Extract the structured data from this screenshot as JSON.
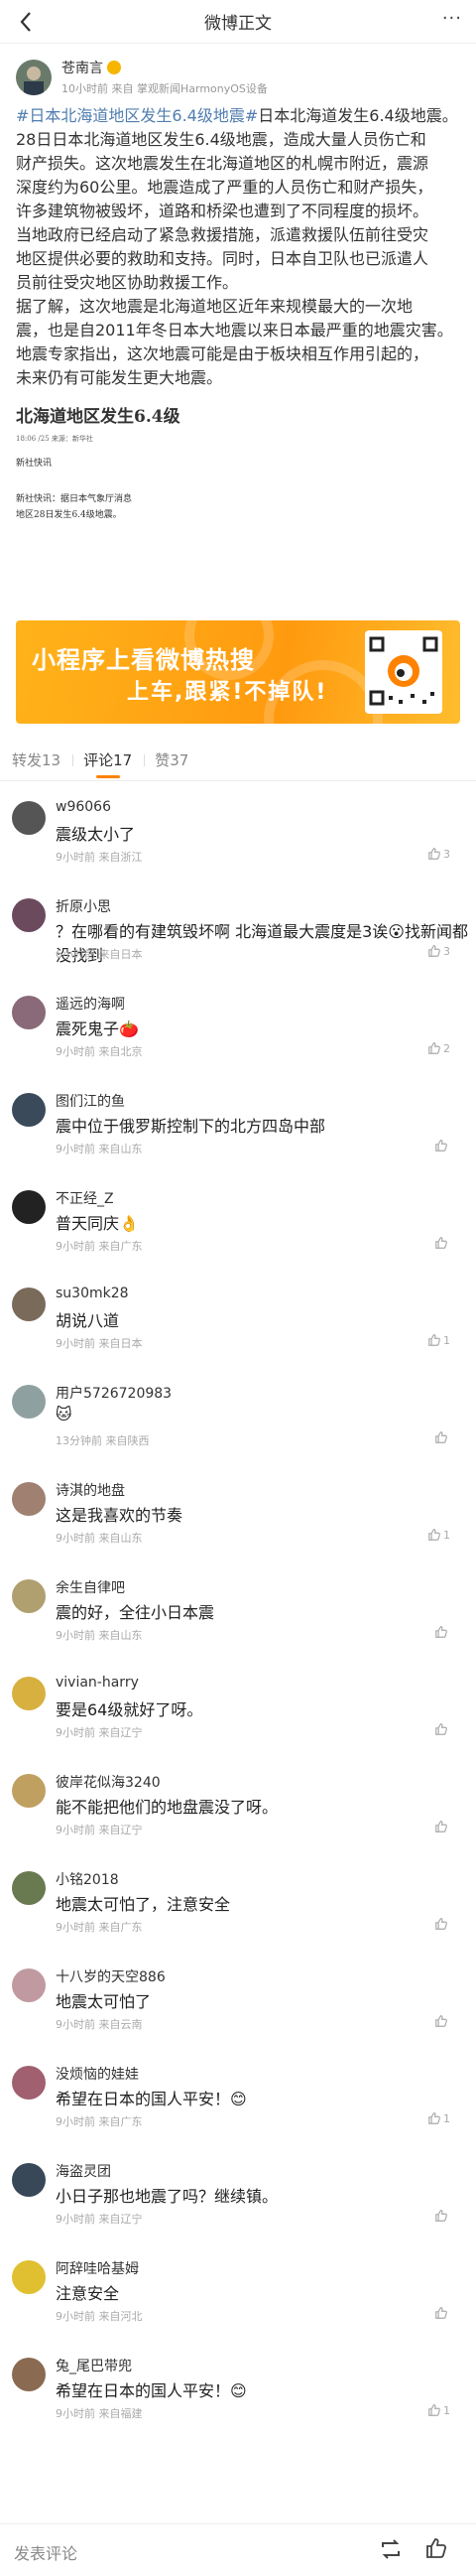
{
  "header": {
    "title": "微博正文",
    "more": "···"
  },
  "post": {
    "author_name": "苍南言",
    "author_meta": "10小时前 来自 掌观新闻HarmonyOS设备",
    "tag1": "#日本北海道地区发生6.4级地震#",
    "after_tag": "日本北海道发生6.4级地震。",
    "body_lines": [
      "28日日本北海道地区发生6.4级地震，造成大量人员伤亡和",
      "财产损失。这次地震发生在北海道地区的札幌市附近，震源",
      "深度约为60公里。地震造成了严重的人员伤亡和财产损失，",
      "许多建筑物被毁坏，道路和桥梁也遭到了不同程度的损坏。",
      "当地政府已经启动了紧急救援措施，派遣救援队伍前往受灾",
      "地区提供必要的救助和支持。同时，日本自卫队也已派遣人",
      "员前往受灾地区协助救援工作。",
      "据了解，这次地震是北海道地区近年来规模最大的一次地",
      "震，也是自2011年冬日本大地震以来日本最严重的地震灾害。",
      "地震专家指出，这次地震可能是由于板块相互作用引起的，",
      "未来仍有可能发生更大地震。"
    ],
    "quote_headline": "北海道地区发生6.4级",
    "quote_sub": "18:06 /25    来源：新华社",
    "quote_agency": "新社快讯",
    "quote_para": "新社快讯：据日本气象厅消息\n地区28日发生6.4级地震。"
  },
  "banner": {
    "line1": "小程序上看微博热搜",
    "line2": "上车,跟紧!不掉队!"
  },
  "tabs": [
    {
      "label": "转发",
      "count": "13"
    },
    {
      "label": "评论",
      "count": "17"
    },
    {
      "label": "赞",
      "count": "37"
    }
  ],
  "comments": [
    {
      "name": "w96066",
      "text": "震级太小了",
      "meta": "9小时前 来自浙江",
      "likes": "3",
      "av": "#555"
    },
    {
      "name": "折原小思",
      "text": "？在哪看的有建筑毁坏啊 北海道最大震度是3诶😮找新闻都没找到",
      "meta": "6小时前 来自日本",
      "likes": "3",
      "av": "#6b4a5e"
    },
    {
      "name": "遥远的海啊",
      "text": "震死鬼子🍅",
      "meta": "9小时前 来自北京",
      "likes": "2",
      "av": "#8a6a78"
    },
    {
      "name": "图们江的鱼",
      "text": "震中位于俄罗斯控制下的北方四岛中部",
      "meta": "9小时前 来自山东",
      "likes": "",
      "av": "#3a4a5a"
    },
    {
      "name": "不正经_Z",
      "text": "普天同庆👌",
      "meta": "9小时前 来自广东",
      "likes": "",
      "av": "#222"
    },
    {
      "name": "su30mk28",
      "text": "胡说八道",
      "meta": "9小时前 来自日本",
      "likes": "1",
      "av": "#7a6a5a"
    },
    {
      "name": "用户5726720983",
      "text": "🐱",
      "meta": "13分钟前 来自陕西",
      "likes": "",
      "av": "#8fa0a0"
    },
    {
      "name": "诗淇的地盘",
      "text": "这是我喜欢的节奏",
      "meta": "9小时前 来自山东",
      "likes": "1",
      "av": "#a08070"
    },
    {
      "name": "余生自律吧",
      "text": "震的好，全往小日本震",
      "meta": "9小时前 来自山东",
      "likes": "",
      "av": "#b0a070"
    },
    {
      "name": "vivian-harry",
      "text": "要是64级就好了呀。",
      "meta": "9小时前 来自辽宁",
      "likes": "",
      "av": "#d8b040"
    },
    {
      "name": "彼岸花似海3240",
      "text": "能不能把他们的地盘震没了呀。",
      "meta": "9小时前 来自辽宁",
      "likes": "",
      "av": "#c0a060"
    },
    {
      "name": "小铭2018",
      "text": "地震太可怕了，注意安全",
      "meta": "9小时前 来自广东",
      "likes": "",
      "av": "#6a7a50"
    },
    {
      "name": "十八岁的天空886",
      "text": "地震太可怕了",
      "meta": "9小时前 来自云南",
      "likes": "",
      "av": "#c09aa0"
    },
    {
      "name": "没烦恼的娃娃",
      "text": "希望在日本的国人平安！😊",
      "meta": "9小时前 来自广东",
      "likes": "1",
      "av": "#a06070"
    },
    {
      "name": "海盗灵团",
      "text": "小日子那也地震了吗？继续镇。",
      "meta": "9小时前 来自辽宁",
      "likes": "",
      "av": "#384858"
    },
    {
      "name": "阿辞哇哈基姆",
      "text": "注意安全",
      "meta": "9小时前 来自河北",
      "likes": "",
      "av": "#e0c030"
    },
    {
      "name": "兔_尾巴带兜",
      "text": "希望在日本的国人平安！😊",
      "meta": "9小时前 来自福建",
      "likes": "1",
      "av": "#8a6a50"
    }
  ],
  "bottom": {
    "placeholder": "发表评论"
  },
  "colors": {
    "accent": "#ff8200",
    "link": "#507daf",
    "banner": "#ffa31a"
  }
}
